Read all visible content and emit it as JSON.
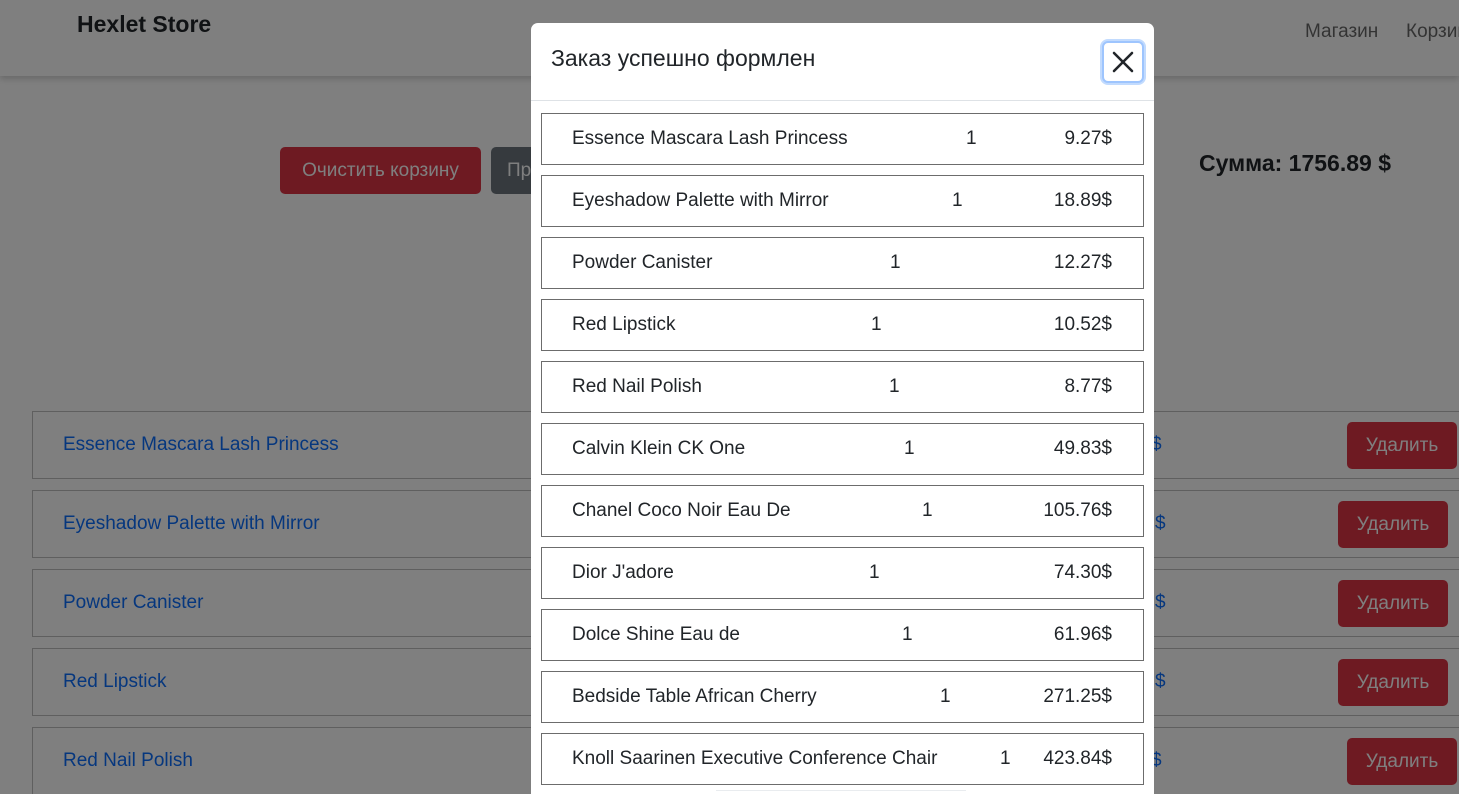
{
  "navbar": {
    "brand": "Hexlet Store",
    "links": [
      "Магазин",
      "Корзина"
    ]
  },
  "cart": {
    "clear_label": "Очистить корзину",
    "checkout_label": "Пр",
    "total_label": "Сумма: 1756.89 $",
    "price_fragment": "$",
    "delete_label": "Удалить",
    "items": [
      {
        "name": "Essence Mascara Lash Princess"
      },
      {
        "name": "Eyeshadow Palette with Mirror"
      },
      {
        "name": "Powder Canister"
      },
      {
        "name": "Red Lipstick"
      },
      {
        "name": "Red Nail Polish"
      }
    ]
  },
  "modal": {
    "title": "Заказ успешно формлен",
    "close_icon": "close-icon",
    "items": [
      {
        "name": "Essence Mascara Lash Princess",
        "qty": "1",
        "price": "9.27$"
      },
      {
        "name": "Eyeshadow Palette with Mirror",
        "qty": "1",
        "price": "18.89$"
      },
      {
        "name": "Powder Canister",
        "qty": "1",
        "price": "12.27$"
      },
      {
        "name": "Red Lipstick",
        "qty": "1",
        "price": "10.52$"
      },
      {
        "name": "Red Nail Polish",
        "qty": "1",
        "price": "8.77$"
      },
      {
        "name": "Calvin Klein CK One",
        "qty": "1",
        "price": "49.83$"
      },
      {
        "name": "Chanel Coco Noir Eau De",
        "qty": "1",
        "price": "105.76$"
      },
      {
        "name": "Dior J'adore",
        "qty": "1",
        "price": "74.30$"
      },
      {
        "name": "Dolce Shine Eau de",
        "qty": "1",
        "price": "61.96$"
      },
      {
        "name": "Bedside Table African Cherry",
        "qty": "1",
        "price": "271.25$"
      },
      {
        "name": "Knoll Saarinen Executive Conference Chair",
        "qty": "1",
        "price": "423.84$"
      }
    ]
  },
  "colors": {
    "danger": "#dc3545",
    "secondary": "#6c757d",
    "link": "#0d6efd",
    "overlay": "rgba(0,0,0,0.5)"
  }
}
